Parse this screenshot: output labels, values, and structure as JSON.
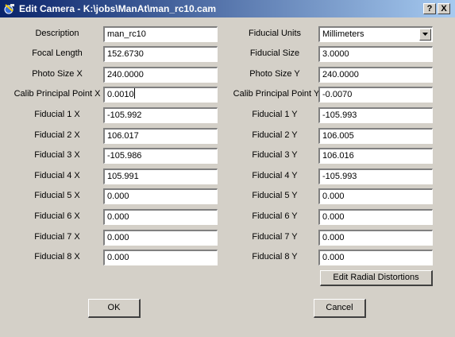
{
  "window": {
    "title": "Edit Camera - K:\\jobs\\ManAt\\man_rc10.cam",
    "help_label": "?",
    "close_label": "X"
  },
  "left_fields": [
    {
      "label": "Description",
      "value": "man_rc10"
    },
    {
      "label": "Focal Length",
      "value": "152.6730"
    },
    {
      "label": "Photo Size X",
      "value": "240.0000"
    },
    {
      "label": "Calib Principal Point X",
      "value": "0.0010"
    },
    {
      "label": "Fiducial 1 X",
      "value": "-105.992"
    },
    {
      "label": "Fiducial 2 X",
      "value": "106.017"
    },
    {
      "label": "Fiducial 3 X",
      "value": "-105.986"
    },
    {
      "label": "Fiducial 4 X",
      "value": "105.991"
    },
    {
      "label": "Fiducial 5 X",
      "value": "0.000"
    },
    {
      "label": "Fiducial 6 X",
      "value": "0.000"
    },
    {
      "label": "Fiducial 7 X",
      "value": "0.000"
    },
    {
      "label": "Fiducial 8 X",
      "value": "0.000"
    }
  ],
  "fiducial_units": {
    "label": "Fiducial Units",
    "selected": "Millimeters"
  },
  "right_fields": [
    {
      "label": "Fiducial Size",
      "value": "3.0000"
    },
    {
      "label": "Photo Size Y",
      "value": "240.0000"
    },
    {
      "label": "Calib Principal Point Y",
      "value": "-0.0070"
    },
    {
      "label": "Fiducial 1 Y",
      "value": "-105.993"
    },
    {
      "label": "Fiducial 2 Y",
      "value": "106.005"
    },
    {
      "label": "Fiducial 3 Y",
      "value": "106.016"
    },
    {
      "label": "Fiducial 4 Y",
      "value": "-105.993"
    },
    {
      "label": "Fiducial 5 Y",
      "value": "0.000"
    },
    {
      "label": "Fiducial 6 Y",
      "value": "0.000"
    },
    {
      "label": "Fiducial 7 Y",
      "value": "0.000"
    },
    {
      "label": "Fiducial 8 Y",
      "value": "0.000"
    }
  ],
  "buttons": {
    "edit_radial": "Edit Radial Distortions",
    "ok": "OK",
    "cancel": "Cancel"
  }
}
